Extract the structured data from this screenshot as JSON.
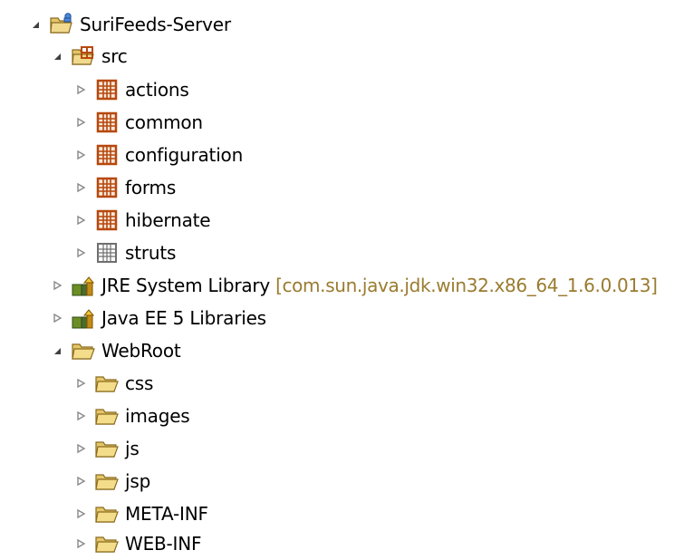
{
  "tree": {
    "root": {
      "label": "SuriFeeds-Server",
      "toggle_icon": "expanded-triangle-icon",
      "icon": "project-icon"
    },
    "src": {
      "label": "src",
      "toggle_icon": "expanded-triangle-icon",
      "icon": "source-folder-icon"
    },
    "packages": [
      {
        "label": "actions",
        "icon": "package-icon",
        "toggle_icon": "collapsed-triangle-icon"
      },
      {
        "label": "common",
        "icon": "package-icon",
        "toggle_icon": "collapsed-triangle-icon"
      },
      {
        "label": "configuration",
        "icon": "package-icon",
        "toggle_icon": "collapsed-triangle-icon"
      },
      {
        "label": "forms",
        "icon": "package-icon",
        "toggle_icon": "collapsed-triangle-icon"
      },
      {
        "label": "hibernate",
        "icon": "package-icon",
        "toggle_icon": "collapsed-triangle-icon"
      },
      {
        "label": "struts",
        "icon": "empty-package-icon",
        "toggle_icon": "collapsed-triangle-icon"
      }
    ],
    "libraries": [
      {
        "label": "JRE System Library",
        "decoration": "[com.sun.java.jdk.win32.x86_64_1.6.0.013]",
        "icon": "library-icon",
        "toggle_icon": "collapsed-triangle-icon"
      },
      {
        "label": "Java EE 5 Libraries",
        "decoration": "",
        "icon": "library-icon",
        "toggle_icon": "collapsed-triangle-icon"
      }
    ],
    "webroot": {
      "label": "WebRoot",
      "toggle_icon": "expanded-triangle-icon",
      "icon": "folder-icon"
    },
    "web_folders": [
      {
        "label": "css",
        "icon": "folder-icon",
        "toggle_icon": "collapsed-triangle-icon"
      },
      {
        "label": "images",
        "icon": "folder-icon",
        "toggle_icon": "collapsed-triangle-icon"
      },
      {
        "label": "js",
        "icon": "folder-icon",
        "toggle_icon": "collapsed-triangle-icon"
      },
      {
        "label": "jsp",
        "icon": "folder-icon",
        "toggle_icon": "collapsed-triangle-icon"
      },
      {
        "label": "META-INF",
        "icon": "folder-icon",
        "toggle_icon": "collapsed-triangle-icon"
      },
      {
        "label": "WEB-INF",
        "icon": "folder-icon",
        "toggle_icon": "collapsed-triangle-icon"
      }
    ]
  },
  "colors": {
    "text": "#000000",
    "decoration": "#9a7b2f",
    "package": "#b7480c",
    "folder": "#d4a11d",
    "library": "#4b6b2f",
    "library_accent": "#c48a15",
    "toggle_collapsed": "#8a8a8a",
    "toggle_expanded": "#404040"
  }
}
